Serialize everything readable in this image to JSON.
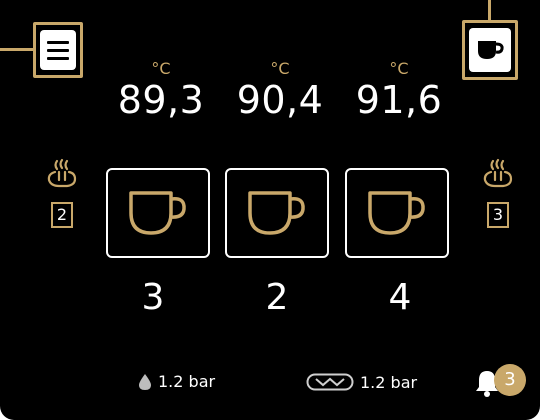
{
  "colors": {
    "accent": "#c9a86a",
    "background": "#000000",
    "text": "#ffffff"
  },
  "header": {
    "menu_icon": "hamburger-menu-icon",
    "cup_icon": "coffee-cup-icon"
  },
  "boilers": [
    {
      "unit": "°C",
      "temperature": "89,3",
      "count": "3"
    },
    {
      "unit": "°C",
      "temperature": "90,4",
      "count": "2"
    },
    {
      "unit": "°C",
      "temperature": "91,6",
      "count": "4"
    }
  ],
  "steam": {
    "left": {
      "icon": "steam-wand-icon",
      "value": "2"
    },
    "right": {
      "icon": "steam-wand-icon",
      "value": "3"
    }
  },
  "status": {
    "water_pressure": "1.2 bar",
    "pump_pressure": "1.2 bar",
    "notifications": "3"
  }
}
